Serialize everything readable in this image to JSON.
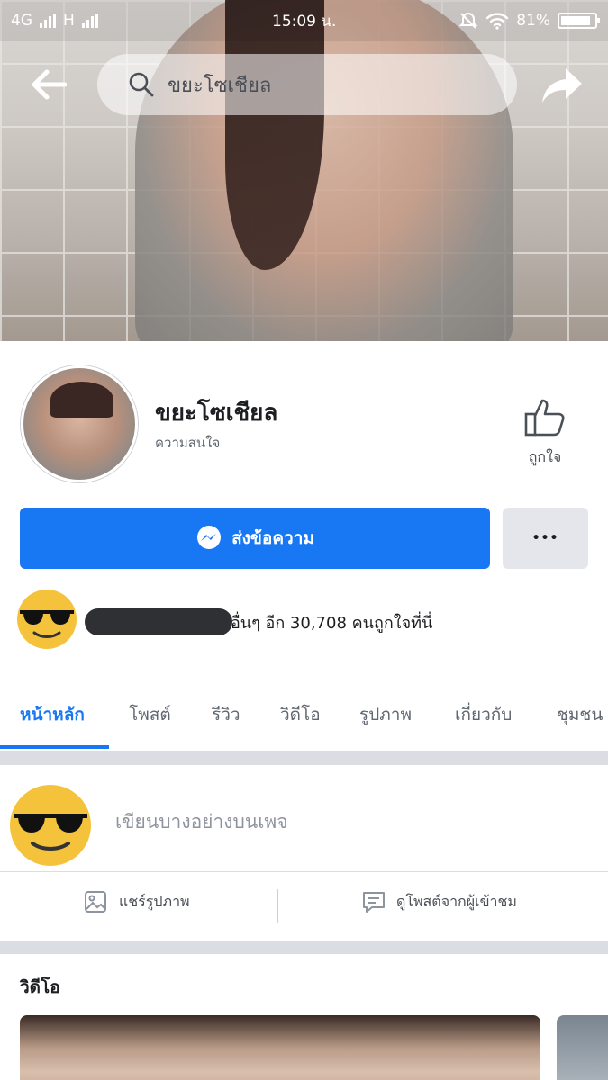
{
  "status_bar": {
    "network_left": "4G",
    "network_right": "H",
    "time": "15:09 น.",
    "battery": "81%"
  },
  "search": {
    "query": "ขยะโซเชียล"
  },
  "page": {
    "name": "ขยะโซเชียล",
    "category": "ความสนใจ",
    "like_label": "ถูกใจ"
  },
  "actions": {
    "message_label": "ส่งข้อความ",
    "more_label": "•••"
  },
  "social": {
    "likes_text": "อื่นๆ อีก 30,708 คนถูกใจที่นี่"
  },
  "tabs": [
    {
      "label": "หน้าหลัก",
      "active": true
    },
    {
      "label": "โพสต์"
    },
    {
      "label": "รีวิว"
    },
    {
      "label": "วิดีโอ"
    },
    {
      "label": "รูปภาพ"
    },
    {
      "label": "เกี่ยวกับ"
    },
    {
      "label": "ชุมชน"
    }
  ],
  "composer": {
    "placeholder": "เขียนบางอย่างบนเพจ",
    "share_photo": "แชร์รูปภาพ",
    "visitor_posts": "ดูโพสต์จากผู้เข้าชม"
  },
  "videos": {
    "title": "วิดีโอ"
  },
  "colors": {
    "accent": "#1877f2",
    "emoji_yellow": "#f5c33b"
  }
}
